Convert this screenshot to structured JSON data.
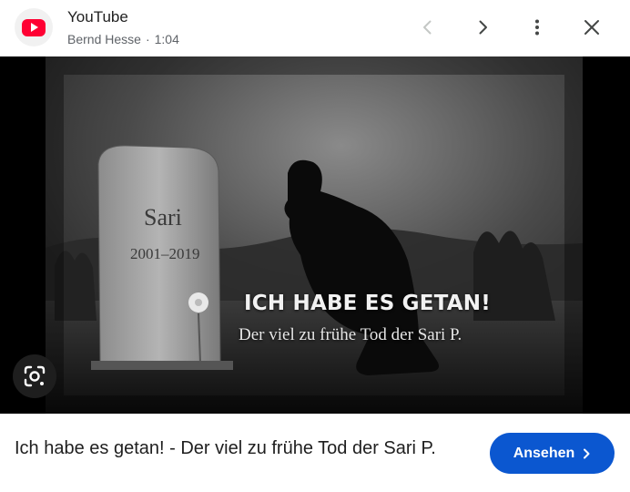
{
  "header": {
    "source_name": "YouTube",
    "channel": "Bernd Hesse",
    "separator": "·",
    "duration": "1:04",
    "icons": [
      "youtube-logo-icon",
      "chevron-left-icon",
      "chevron-right-icon",
      "more-vert-icon",
      "close-icon"
    ]
  },
  "media": {
    "overlay_title": "ICH HABE ES GETAN!",
    "overlay_subtitle": "Der viel zu frühe Tod der Sari P.",
    "gravestone_name": "Sari",
    "gravestone_dates": "2001–2019",
    "lens_icon": "google-lens-icon"
  },
  "footer": {
    "title": "Ich habe es getan! - Der viel zu frühe Tod der Sari P.",
    "watch_label": "Ansehen"
  },
  "colors": {
    "brand_red": "#ff0033",
    "button_blue": "#0b57d0",
    "text_primary": "#1f1f1f",
    "text_secondary": "#5f6368"
  }
}
